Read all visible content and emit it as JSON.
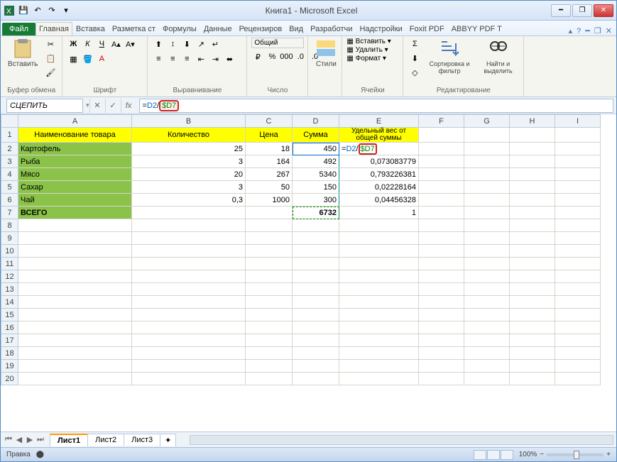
{
  "title": "Книга1  -  Microsoft Excel",
  "qat": {
    "save": "💾",
    "undo": "↶",
    "redo": "↷"
  },
  "tabs": {
    "file": "Файл",
    "list": [
      "Главная",
      "Вставка",
      "Разметка ст",
      "Формулы",
      "Данные",
      "Рецензиров",
      "Вид",
      "Разработчи",
      "Надстройки",
      "Foxit PDF",
      "ABBYY PDF T"
    ],
    "active": 0
  },
  "ribbon": {
    "clipboard": {
      "label": "Буфер обмена",
      "paste": "Вставить"
    },
    "font": {
      "label": "Шрифт"
    },
    "align": {
      "label": "Выравнивание"
    },
    "number": {
      "label": "Число",
      "format": "Общий"
    },
    "styles": {
      "label": "",
      "btn": "Стили"
    },
    "cells": {
      "label": "Ячейки",
      "insert": "Вставить",
      "delete": "Удалить",
      "format": "Формат"
    },
    "editing": {
      "label": "Редактирование",
      "sort": "Сортировка и фильтр",
      "find": "Найти и выделить"
    }
  },
  "formula_bar": {
    "name_box": "СЦЕПИТЬ",
    "formula_prefix": "=",
    "ref1": "D2",
    "sep": "/",
    "ref2": "$D7"
  },
  "columns": [
    "A",
    "B",
    "C",
    "D",
    "E",
    "F",
    "G",
    "H",
    "I"
  ],
  "headers": {
    "A": "Наименование товара",
    "B": "Количество",
    "C": "Цена",
    "D": "Сумма",
    "E": "Удельный вес от общей суммы"
  },
  "rows": [
    {
      "name": "Картофель",
      "qty": "25",
      "price": "18",
      "sum": "450",
      "weight_edit": true
    },
    {
      "name": "Рыба",
      "qty": "3",
      "price": "164",
      "sum": "492",
      "weight": "0,073083779"
    },
    {
      "name": "Мясо",
      "qty": "20",
      "price": "267",
      "sum": "5340",
      "weight": "0,793226381"
    },
    {
      "name": "Сахар",
      "qty": "3",
      "price": "50",
      "sum": "150",
      "weight": "0,02228164"
    },
    {
      "name": "Чай",
      "qty": "0,3",
      "price": "1000",
      "sum": "300",
      "weight": "0,04456328"
    }
  ],
  "total": {
    "label": "ВСЕГО",
    "sum": "6732",
    "weight": "1"
  },
  "sheets": {
    "list": [
      "Лист1",
      "Лист2",
      "Лист3"
    ],
    "active": 0
  },
  "status": {
    "mode": "Правка",
    "zoom": "100%"
  }
}
